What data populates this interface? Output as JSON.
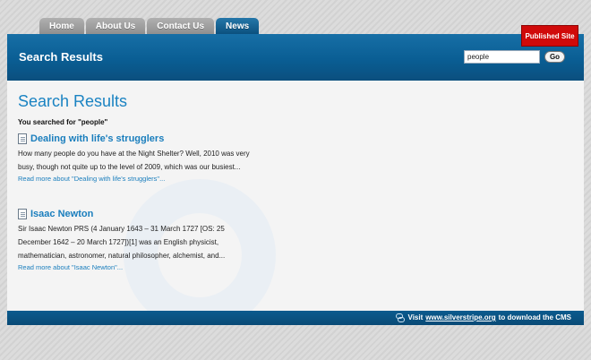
{
  "nav": {
    "tabs": [
      {
        "label": "Home",
        "active": false
      },
      {
        "label": "About Us",
        "active": false
      },
      {
        "label": "Contact Us",
        "active": false
      },
      {
        "label": "News",
        "active": true
      }
    ]
  },
  "published_button": "Published Site",
  "header": {
    "title": "Search Results",
    "search_value": "people",
    "go_label": "Go"
  },
  "main": {
    "heading": "Search Results",
    "searched_for": "You searched for \"people\"",
    "results": [
      {
        "title": "Dealing with life's strugglers",
        "snippet": "How many people do you have at the Night Shelter? Well, 2010 was very busy, though not quite up to the level of 2009, which was our busiest...",
        "read_more": "Read more about \"Dealing with life's strugglers\"..."
      },
      {
        "title": "Isaac Newton",
        "snippet": "Sir Isaac Newton PRS (4 January 1643 – 31 March 1727 [OS: 25 December 1642 – 20 March 1727])[1] was an English physicist, mathematician, astronomer, natural philosopher, alchemist, and...",
        "read_more": "Read more about \"Isaac Newton\"..."
      }
    ]
  },
  "footer": {
    "prefix": "Visit",
    "link": "www.silverstripe.org",
    "suffix": "to download the CMS"
  },
  "colors": {
    "brand_blue": "#0a5e94",
    "link_blue": "#1a7ebd",
    "published_red": "#d00a0a"
  }
}
